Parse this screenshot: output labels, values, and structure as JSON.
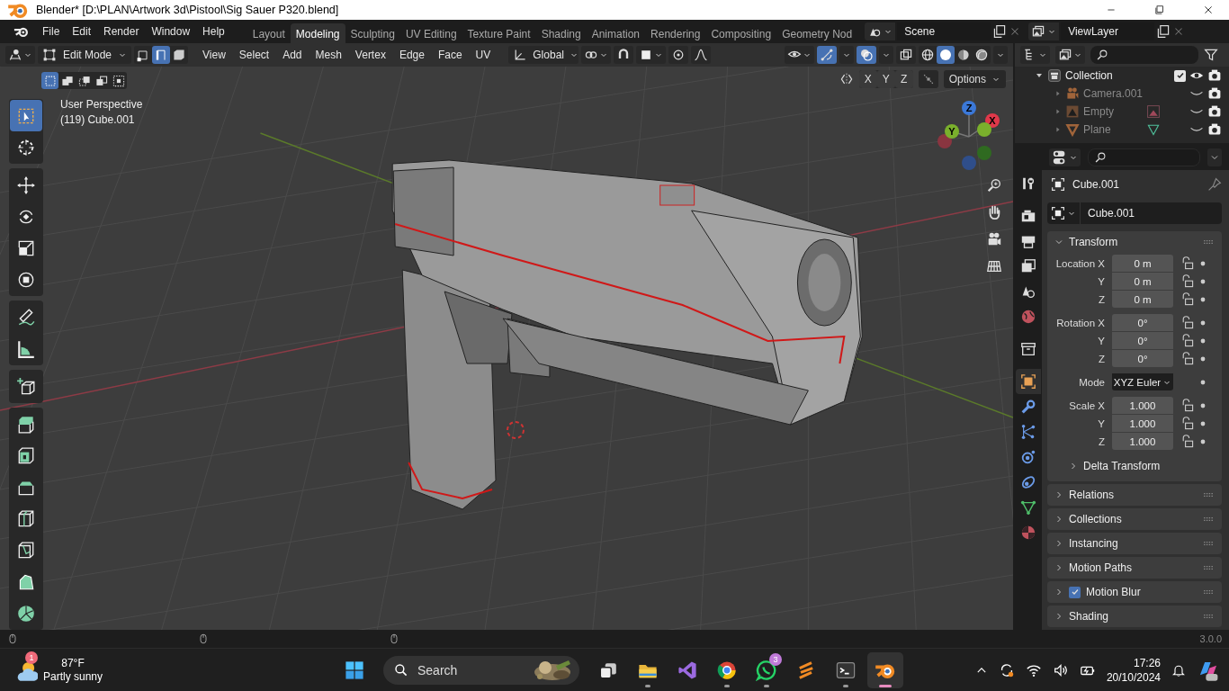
{
  "window": {
    "title": "Blender* [D:\\PLAN\\Artwork 3d\\Pistool\\Sig Sauer P320.blend]"
  },
  "menu": [
    "File",
    "Edit",
    "Render",
    "Window",
    "Help"
  ],
  "workspaces": [
    {
      "label": "Layout",
      "selected": false
    },
    {
      "label": "Modeling",
      "selected": true
    },
    {
      "label": "Sculpting",
      "selected": false
    },
    {
      "label": "UV Editing",
      "selected": false
    },
    {
      "label": "Texture Paint",
      "selected": false
    },
    {
      "label": "Shading",
      "selected": false
    },
    {
      "label": "Animation",
      "selected": false
    },
    {
      "label": "Rendering",
      "selected": false
    },
    {
      "label": "Compositing",
      "selected": false
    },
    {
      "label": "Geometry Nod",
      "selected": false
    }
  ],
  "scene": {
    "value": "Scene"
  },
  "view_layer": {
    "value": "ViewLayer"
  },
  "viewport": {
    "mode": "Edit Mode",
    "select_modes": [
      {
        "kind": "vertex",
        "selected": false
      },
      {
        "kind": "edge",
        "selected": true
      },
      {
        "kind": "face",
        "selected": false
      }
    ],
    "menus": [
      "View",
      "Select",
      "Add",
      "Mesh",
      "Vertex",
      "Edge",
      "Face",
      "UV"
    ],
    "orientation": "Global",
    "left_toggles": [
      {
        "kind": "snap",
        "on": false
      },
      {
        "kind": "proportional",
        "on": false
      }
    ],
    "right_toggles": [
      {
        "kind": "gizmo",
        "on": true
      },
      {
        "kind": "overlay",
        "on": true
      },
      {
        "kind": "xray",
        "on": false
      }
    ],
    "shading": [
      {
        "kind": "wire",
        "selected": false
      },
      {
        "kind": "solid",
        "selected": true
      },
      {
        "kind": "material",
        "selected": false
      },
      {
        "kind": "rendered",
        "selected": false
      }
    ],
    "box_modes": [
      {
        "kind": "new",
        "selected": true
      },
      {
        "kind": "extend",
        "selected": false
      },
      {
        "kind": "subtract",
        "selected": false
      },
      {
        "kind": "invert",
        "selected": false
      },
      {
        "kind": "intersect",
        "selected": false
      }
    ],
    "mirror_axes": [
      {
        "label": "X",
        "on": false
      },
      {
        "label": "Y",
        "on": false
      },
      {
        "label": "Z",
        "on": false
      }
    ],
    "options": "Options",
    "info": [
      "User Perspective",
      "(119) Cube.001"
    ],
    "tool_groups": [
      [
        {
          "kind": "select",
          "selected": true
        },
        {
          "kind": "cursor",
          "selected": false
        }
      ],
      [
        {
          "kind": "move",
          "selected": false
        },
        {
          "kind": "rotate",
          "selected": false
        },
        {
          "kind": "scale",
          "selected": false
        },
        {
          "kind": "transform",
          "selected": false
        }
      ],
      [
        {
          "kind": "annotate",
          "selected": false
        },
        {
          "kind": "measure",
          "selected": false
        }
      ],
      [
        {
          "kind": "add_cube",
          "selected": false
        }
      ],
      [
        {
          "kind": "extrude",
          "selected": false
        },
        {
          "kind": "inset",
          "selected": false
        },
        {
          "kind": "bevel",
          "selected": false
        },
        {
          "kind": "loop_cut",
          "selected": false
        },
        {
          "kind": "knife",
          "selected": false
        },
        {
          "kind": "poly_build",
          "selected": false
        },
        {
          "kind": "spin",
          "selected": false
        }
      ]
    ],
    "gizmo_axes": [
      "Z",
      "Y",
      "X"
    ]
  },
  "outliner": {
    "tree": [
      {
        "name": "Collection",
        "kind": "collection",
        "checked": true,
        "visible": true,
        "expanded": true,
        "children": [
          {
            "name": "Camera.001",
            "kind": "camera",
            "visible": false
          },
          {
            "name": "Empty",
            "kind": "empty",
            "visible": false
          },
          {
            "name": "Plane",
            "kind": "mesh",
            "visible": false
          }
        ]
      }
    ]
  },
  "properties": {
    "tabs": [
      {
        "kind": "tool",
        "selected": false
      },
      {
        "kind": "render",
        "selected": false
      },
      {
        "kind": "output",
        "selected": false
      },
      {
        "kind": "view_layer",
        "selected": false
      },
      {
        "kind": "scene",
        "selected": false
      },
      {
        "kind": "world",
        "selected": false
      },
      {
        "kind": "collection",
        "selected": false
      },
      {
        "kind": "object",
        "selected": true
      },
      {
        "kind": "modifiers",
        "selected": false
      },
      {
        "kind": "particles",
        "selected": false
      },
      {
        "kind": "physics",
        "selected": false
      },
      {
        "kind": "constraints",
        "selected": false
      },
      {
        "kind": "data",
        "selected": false
      },
      {
        "kind": "material",
        "selected": false
      }
    ],
    "object_name": "Cube.001",
    "data_name": "Cube.001",
    "transform": {
      "title": "Transform",
      "expanded": true,
      "groups": [
        [
          {
            "label": "Location X",
            "value": "0 m",
            "kind": "number"
          },
          {
            "label": "Y",
            "value": "0 m",
            "kind": "number"
          },
          {
            "label": "Z",
            "value": "0 m",
            "kind": "number"
          }
        ],
        [
          {
            "label": "Rotation X",
            "value": "0°",
            "kind": "number"
          },
          {
            "label": "Y",
            "value": "0°",
            "kind": "number"
          },
          {
            "label": "Z",
            "value": "0°",
            "kind": "number"
          }
        ],
        [
          {
            "label": "Mode",
            "value": "XYZ Euler",
            "kind": "dropdown"
          }
        ],
        [
          {
            "label": "Scale X",
            "value": "1.000",
            "kind": "number"
          },
          {
            "label": "Y",
            "value": "1.000",
            "kind": "number"
          },
          {
            "label": "Z",
            "value": "1.000",
            "kind": "number"
          }
        ]
      ],
      "subpanels": [
        {
          "title": "Delta Transform",
          "expanded": false
        }
      ]
    },
    "panels": [
      {
        "title": "Relations",
        "kind": "plain",
        "expanded": false
      },
      {
        "title": "Collections",
        "kind": "plain",
        "expanded": false
      },
      {
        "title": "Instancing",
        "kind": "plain",
        "expanded": false
      },
      {
        "title": "Motion Paths",
        "kind": "plain",
        "expanded": false
      },
      {
        "title": "Motion Blur",
        "kind": "checkbox",
        "checked": true,
        "expanded": false
      },
      {
        "title": "Shading",
        "kind": "plain",
        "expanded": false
      }
    ]
  },
  "status_bar": {
    "version": "3.0.0"
  },
  "taskbar": {
    "weather": {
      "badge": "1",
      "temperature": "87°F",
      "condition": "Partly sunny"
    },
    "search": {
      "label": "Search"
    },
    "apps": [
      {
        "kind": "task_view",
        "running": false,
        "active": false
      },
      {
        "kind": "explorer",
        "running": true,
        "active": false
      },
      {
        "kind": "ide",
        "running": false,
        "active": false
      },
      {
        "kind": "browser",
        "running": true,
        "active": false
      },
      {
        "kind": "chat",
        "running": true,
        "active": false,
        "badge": "3"
      },
      {
        "kind": "editor",
        "running": false,
        "active": false
      },
      {
        "kind": "terminal",
        "running": true,
        "active": false
      },
      {
        "kind": "blender",
        "running": true,
        "active": true
      }
    ],
    "clock": {
      "time": "17:26",
      "date": "20/10/2024"
    }
  }
}
